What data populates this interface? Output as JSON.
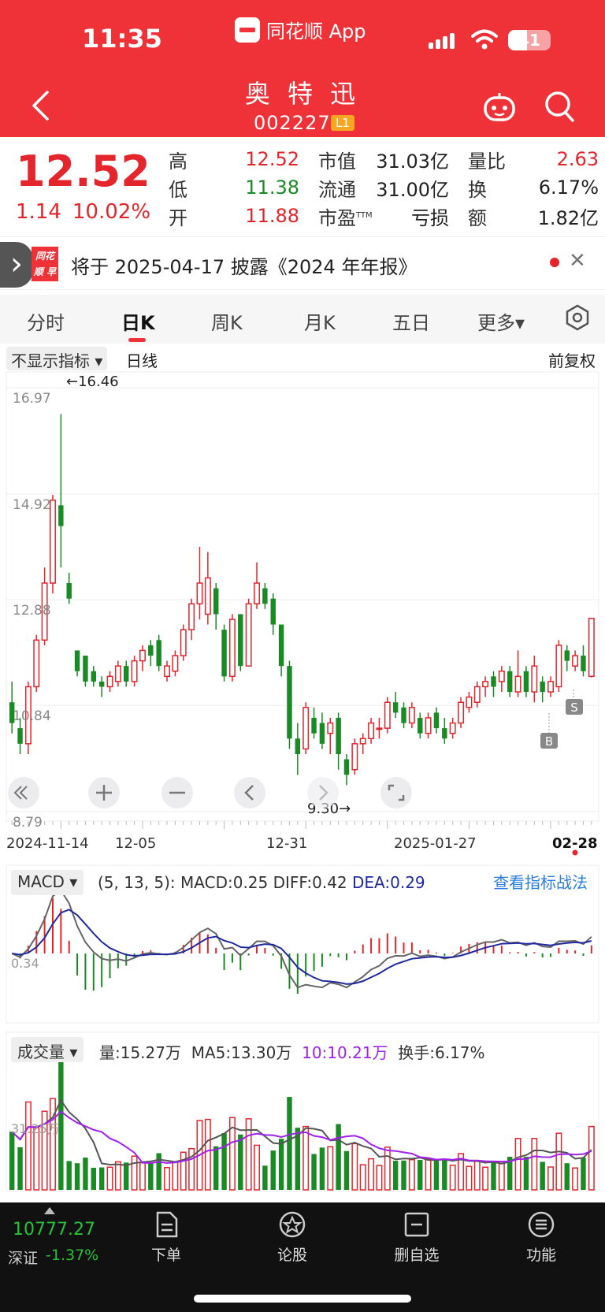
{
  "status": {
    "time": "11:35",
    "app_name": "同花顺 App",
    "battery": "41"
  },
  "header": {
    "stock_name": "奥 特 迅",
    "stock_code": "002227",
    "level": "L1"
  },
  "quote": {
    "price": "12.52",
    "change": "1.14",
    "change_pct": "10.02%",
    "fields": [
      {
        "label": "高",
        "value": "12.52"
      },
      {
        "label": "低",
        "value": "11.38"
      },
      {
        "label": "开",
        "value": "11.88"
      },
      {
        "label": "市值",
        "value": "31.03亿"
      },
      {
        "label": "流通",
        "value": "31.00亿"
      },
      {
        "label": "市盈",
        "value": "亏损",
        "sup": "TTM"
      },
      {
        "label": "量比",
        "value": "2.63"
      },
      {
        "label": "换",
        "value": "6.17%"
      },
      {
        "label": "额",
        "value": "1.82亿"
      }
    ]
  },
  "notice": {
    "badge": "同花顺 早讲",
    "text": "将于 2025-04-17 披露《2024 年年报》"
  },
  "tabs": [
    "分时",
    "日K",
    "周K",
    "月K",
    "五日",
    "更多▾"
  ],
  "active_tab": "日K",
  "kline": {
    "indicator_selector": "不显示指标 ▾",
    "period_label": "日线",
    "adjust_label": "前复权",
    "y_ticks": [
      "16.97",
      "14.92",
      "12.88",
      "10.84",
      "8.79"
    ],
    "max_label": "←16.46",
    "min_label": "9.30→",
    "x_ticks": [
      "2024-11-14",
      "12-05",
      "12-31",
      "2025-01-27",
      "02-28"
    ],
    "markers": [
      "B",
      "S"
    ]
  },
  "macd": {
    "selector": "MACD ▾",
    "params": "(5, 13, 5):",
    "macd": "MACD:0.25",
    "diff": "DIFF:0.42",
    "dea": "DEA:0.29",
    "axis_label": "0.34",
    "link": "查看指标战法"
  },
  "volume": {
    "selector": "成交量 ▾",
    "vol": "量:15.27万",
    "ma5": "MA5:13.30万",
    "ma10": "10:10.21万",
    "turnover": "换手:6.17%",
    "axis_label": "31.25万"
  },
  "chart_data": {
    "type": "candlestick",
    "x": [
      "2024-11-14",
      "12-05",
      "12-31",
      "2025-01-27",
      "02-28"
    ],
    "y_axis_ticks": [
      16.97,
      14.92,
      12.88,
      10.84,
      8.79
    ],
    "ylim": [
      8.79,
      16.97
    ],
    "annotations": {
      "high": 16.46,
      "low": 9.3
    },
    "series": [
      {
        "open": 10.9,
        "close": 10.5,
        "high": 11.3,
        "low": 10.3
      },
      {
        "open": 10.4,
        "close": 10.1,
        "high": 10.6,
        "low": 9.9
      },
      {
        "open": 10.1,
        "close": 11.2,
        "high": 11.3,
        "low": 9.9
      },
      {
        "open": 11.2,
        "close": 12.1,
        "high": 12.2,
        "low": 11.1
      },
      {
        "open": 12.1,
        "close": 13.2,
        "high": 13.5,
        "low": 12.0
      },
      {
        "open": 13.2,
        "close": 14.8,
        "high": 14.9,
        "low": 13.0
      },
      {
        "open": 14.7,
        "close": 14.3,
        "high": 16.46,
        "low": 13.5
      },
      {
        "open": 13.2,
        "close": 12.9,
        "high": 13.4,
        "low": 12.8
      },
      {
        "open": 11.9,
        "close": 11.5,
        "high": 11.9,
        "low": 11.4
      },
      {
        "open": 11.8,
        "close": 11.3,
        "high": 11.8,
        "low": 11.2
      },
      {
        "open": 11.5,
        "close": 11.3,
        "high": 11.6,
        "low": 11.2
      },
      {
        "open": 11.3,
        "close": 11.2,
        "high": 11.4,
        "low": 11.0
      },
      {
        "open": 11.2,
        "close": 11.4,
        "high": 11.5,
        "low": 11.1
      },
      {
        "open": 11.3,
        "close": 11.6,
        "high": 11.7,
        "low": 11.2
      },
      {
        "open": 11.6,
        "close": 11.3,
        "high": 11.7,
        "low": 11.2
      },
      {
        "open": 11.3,
        "close": 11.7,
        "high": 11.8,
        "low": 11.2
      },
      {
        "open": 11.7,
        "close": 11.9,
        "high": 12.0,
        "low": 11.5
      },
      {
        "open": 12.0,
        "close": 11.8,
        "high": 12.1,
        "low": 11.6
      },
      {
        "open": 12.1,
        "close": 11.6,
        "high": 12.2,
        "low": 11.5
      },
      {
        "open": 11.4,
        "close": 11.6,
        "high": 11.7,
        "low": 11.3
      },
      {
        "open": 11.5,
        "close": 11.8,
        "high": 11.9,
        "low": 11.4
      },
      {
        "open": 11.8,
        "close": 12.3,
        "high": 12.4,
        "low": 11.7
      },
      {
        "open": 12.3,
        "close": 12.8,
        "high": 12.9,
        "low": 12.1
      },
      {
        "open": 12.8,
        "close": 13.2,
        "high": 13.9,
        "low": 12.5
      },
      {
        "open": 12.6,
        "close": 13.3,
        "high": 13.8,
        "low": 12.4
      },
      {
        "open": 13.1,
        "close": 12.6,
        "high": 13.2,
        "low": 12.3
      },
      {
        "open": 12.3,
        "close": 11.4,
        "high": 12.4,
        "low": 11.3
      },
      {
        "open": 11.4,
        "close": 12.5,
        "high": 12.6,
        "low": 11.3
      },
      {
        "open": 12.6,
        "close": 11.6,
        "high": 12.6,
        "low": 11.5
      },
      {
        "open": 11.6,
        "close": 12.8,
        "high": 12.9,
        "low": 11.6
      },
      {
        "open": 12.8,
        "close": 13.2,
        "high": 13.6,
        "low": 12.7
      },
      {
        "open": 13.1,
        "close": 12.8,
        "high": 13.2,
        "low": 12.7
      },
      {
        "open": 12.9,
        "close": 12.4,
        "high": 13.0,
        "low": 12.2
      },
      {
        "open": 12.4,
        "close": 11.6,
        "high": 12.4,
        "low": 11.4
      },
      {
        "open": 11.6,
        "close": 10.2,
        "high": 11.7,
        "low": 10.0
      },
      {
        "open": 10.2,
        "close": 9.9,
        "high": 10.5,
        "low": 9.5
      },
      {
        "open": 10.0,
        "close": 10.8,
        "high": 10.9,
        "low": 9.9
      },
      {
        "open": 10.6,
        "close": 10.3,
        "high": 10.8,
        "low": 10.2
      },
      {
        "open": 10.5,
        "close": 10.1,
        "high": 10.7,
        "low": 10.0
      },
      {
        "open": 10.3,
        "close": 10.5,
        "high": 10.6,
        "low": 9.9
      },
      {
        "open": 10.6,
        "close": 9.9,
        "high": 10.7,
        "low": 9.6
      },
      {
        "open": 9.8,
        "close": 9.5,
        "high": 9.9,
        "low": 9.3
      },
      {
        "open": 9.6,
        "close": 10.1,
        "high": 10.2,
        "low": 9.5
      },
      {
        "open": 10.1,
        "close": 10.2,
        "high": 10.3,
        "low": 9.9
      },
      {
        "open": 10.2,
        "close": 10.5,
        "high": 10.6,
        "low": 10.1
      },
      {
        "open": 10.4,
        "close": 10.4,
        "high": 10.6,
        "low": 10.2
      },
      {
        "open": 10.4,
        "close": 10.9,
        "high": 11.0,
        "low": 10.3
      },
      {
        "open": 10.9,
        "close": 10.7,
        "high": 11.1,
        "low": 10.6
      },
      {
        "open": 10.8,
        "close": 10.5,
        "high": 10.9,
        "low": 10.4
      },
      {
        "open": 10.5,
        "close": 10.8,
        "high": 10.9,
        "low": 10.4
      },
      {
        "open": 10.6,
        "close": 10.3,
        "high": 10.7,
        "low": 10.2
      },
      {
        "open": 10.3,
        "close": 10.6,
        "high": 10.7,
        "low": 10.2
      },
      {
        "open": 10.7,
        "close": 10.4,
        "high": 10.8,
        "low": 10.3
      },
      {
        "open": 10.4,
        "close": 10.2,
        "high": 10.6,
        "low": 10.1
      },
      {
        "open": 10.3,
        "close": 10.5,
        "high": 10.6,
        "low": 10.2
      },
      {
        "open": 10.5,
        "close": 10.9,
        "high": 11.0,
        "low": 10.4
      },
      {
        "open": 10.8,
        "close": 11.0,
        "high": 11.1,
        "low": 10.7
      },
      {
        "open": 10.9,
        "close": 11.2,
        "high": 11.3,
        "low": 10.8
      },
      {
        "open": 11.2,
        "close": 11.3,
        "high": 11.4,
        "low": 11.0
      },
      {
        "open": 11.4,
        "close": 11.2,
        "high": 11.5,
        "low": 11.0
      },
      {
        "open": 11.3,
        "close": 11.5,
        "high": 11.6,
        "low": 11.1
      },
      {
        "open": 11.5,
        "close": 11.1,
        "high": 11.6,
        "low": 11.0
      },
      {
        "open": 11.1,
        "close": 11.4,
        "high": 11.9,
        "low": 11.0
      },
      {
        "open": 11.5,
        "close": 11.1,
        "high": 11.6,
        "low": 11.0
      },
      {
        "open": 11.1,
        "close": 11.6,
        "high": 11.8,
        "low": 10.9
      },
      {
        "open": 11.3,
        "close": 11.1,
        "high": 11.4,
        "low": 10.9
      },
      {
        "open": 11.1,
        "close": 11.3,
        "high": 11.4,
        "low": 11.0
      },
      {
        "open": 11.2,
        "close": 12.0,
        "high": 12.1,
        "low": 11.1
      },
      {
        "open": 11.9,
        "close": 11.7,
        "high": 12.0,
        "low": 11.5
      },
      {
        "open": 11.6,
        "close": 11.8,
        "high": 11.9,
        "low": 11.5
      },
      {
        "open": 11.8,
        "close": 11.5,
        "high": 12.0,
        "low": 11.4
      },
      {
        "open": 11.4,
        "close": 12.52,
        "high": 12.52,
        "low": 11.38
      }
    ]
  }
}
